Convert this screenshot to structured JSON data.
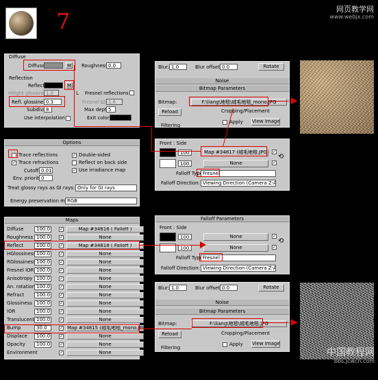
{
  "step_number": "7",
  "watermark_top": {
    "line1": "网页教学网",
    "line2": "www.webjx.com"
  },
  "watermark_bottom": {
    "line1": "中国教程网",
    "line2": "bbs.jcwcn.com"
  },
  "diffuse": {
    "title": "Diffuse",
    "diffuse_label": "Diffuse",
    "m_label": "M",
    "roughness_label": "Roughness",
    "roughness_value": "0.0"
  },
  "reflection": {
    "title": "Reflection",
    "reflect_label": "Reflect",
    "m_label": "M",
    "hilight_label": "Hilight glossiness",
    "hilight_value": "1.0",
    "l_label": "L",
    "fresnel_label": "Fresnel reflections",
    "refl_gloss_label": "Refl. glossiness",
    "refl_gloss_value": "0.3",
    "fresnel_ior_label": "Fresnel IOR",
    "fresnel_ior_value": "1.6",
    "subdivs_label": "Subdivs",
    "subdivs_value": "8",
    "max_depth_label": "Max depth",
    "max_depth_value": "5",
    "use_interp_label": "Use interpolation",
    "exit_color_label": "Exit color"
  },
  "options": {
    "title": "Options",
    "trace_reflections": "Trace reflections",
    "trace_refractions": "Trace refractions",
    "cutoff_label": "Cutoff",
    "cutoff_value": "0.01",
    "env_priority_label": "Env. priority",
    "env_priority_value": "0",
    "double_sided": "Double-sided",
    "reflect_on_back": "Reflect on back side",
    "use_irradiance": "Use irradiance map",
    "glossy_label": "Treat glossy rays as GI rays:",
    "glossy_value": "Only for GI rays",
    "energy_label": "Energy preservation mode:",
    "energy_value": "RGB"
  },
  "maps": {
    "title": "Maps",
    "rows": [
      {
        "label": "Diffuse",
        "amount": "100.0",
        "map": "Map #34816  ( Falloff )"
      },
      {
        "label": "Roughness",
        "amount": "100.0",
        "map": "None"
      },
      {
        "label": "Reflect",
        "amount": "100.0",
        "map": "Map #34818  ( Falloff )"
      },
      {
        "label": "HGlossiness",
        "amount": "100.0",
        "map": "None"
      },
      {
        "label": "RGlossiness",
        "amount": "100.0",
        "map": "None"
      },
      {
        "label": "Fresnel IOR",
        "amount": "100.0",
        "map": "None"
      },
      {
        "label": "Anisotropy",
        "amount": "100.0",
        "map": "None"
      },
      {
        "label": "An. rotation",
        "amount": "100.0",
        "map": "None"
      },
      {
        "label": "Refract",
        "amount": "100.0",
        "map": "None"
      },
      {
        "label": "Glossiness",
        "amount": "100.0",
        "map": "None"
      },
      {
        "label": "IOR",
        "amount": "100.0",
        "map": "None"
      },
      {
        "label": "Translucent",
        "amount": "100.0",
        "map": "None"
      },
      {
        "label": "Bump",
        "amount": "30.0",
        "map": "Map #34815 (绒毛地毯_mono.JPG)"
      },
      {
        "label": "Displace",
        "amount": "100.0",
        "map": "None"
      },
      {
        "label": "Opacity",
        "amount": "100.0",
        "map": "None"
      },
      {
        "label": "Environment",
        "amount": "",
        "map": "None"
      }
    ]
  },
  "bitmap1": {
    "blur_label": "Blur:",
    "blur_value": "1.0",
    "blur_offset_label": "Blur offset:",
    "blur_offset_value": "0.0",
    "rotate_label": "Rotate",
    "noise_label": "Noise",
    "params_label": "Bitmap Parameters",
    "bitmap_label": "Bitmap:",
    "path": "F:\\liang\\地毯\\绒毛地毯_mono.JPG",
    "reload_label": "Reload",
    "cropping_label": "Cropping/Placement",
    "apply_label": "Apply",
    "view_image_label": "View Image",
    "filtering_label": "Filtering"
  },
  "falloff1": {
    "front_side_label": "Front : Side",
    "row1_value": "100.0",
    "row1_map": "Map #34817 (绒毛地毯.JPG)",
    "row2_value": "100.0",
    "row2_map": "None",
    "type_label": "Falloff Type:",
    "type_value": "Fresnel",
    "direction_label": "Falloff Direction:",
    "direction_value": "Viewing Direction (Camera Z-Axis)"
  },
  "falloff2": {
    "title": "Falloff Parameters",
    "front_side_label": "Front : Side",
    "row1_value": "100.0",
    "row1_map": "None",
    "row2_value": "100.0",
    "row2_map": "None",
    "type_label": "Falloff Type:",
    "type_value": "Fresnel",
    "direction_label": "Falloff Direction:",
    "direction_value": "Viewing Direction (Camera Z-Axis)"
  },
  "bitmap2": {
    "blur_label": "Blur:",
    "blur_value": "1.0",
    "blur_offset_label": "Blur offset:",
    "blur_offset_value": "0.0",
    "rotate_label": "Rotate",
    "noise_label": "Noise",
    "params_label": "Bitmap Parameters",
    "bitmap_label": "Bitmap:",
    "path": "F:\\liang\\地毯\\绒毛地毯.JPG",
    "reload_label": "Reload",
    "cropping_label": "Cropping/Placement",
    "apply_label": "Apply",
    "view_image_label": "View Image",
    "filtering_label": "Filtering"
  },
  "colors": {
    "accent_red": "#e00000",
    "panel": "#c8c8c8"
  }
}
